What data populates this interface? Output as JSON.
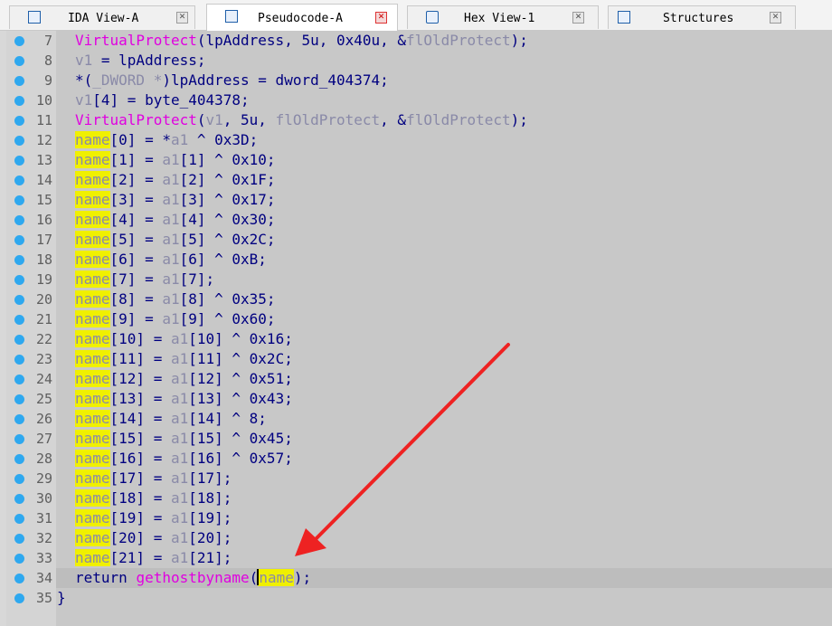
{
  "tabs": [
    {
      "label": "IDA View-A",
      "active": false,
      "icon": "ida-view-icon"
    },
    {
      "label": "Pseudocode-A",
      "active": true,
      "icon": "pseudocode-icon"
    },
    {
      "label": "Hex View-1",
      "active": false,
      "icon": "hex-view-icon"
    },
    {
      "label": "Structures",
      "active": false,
      "icon": "structures-icon"
    }
  ],
  "close_glyph": "✕",
  "colors": {
    "function": "#e000e0",
    "variable": "#8a8aa8",
    "keyword": "#000080",
    "highlight": "#f0f000",
    "breakpoint_dot": "#2ea8ef",
    "arrow": "#ee2222"
  },
  "lines": [
    {
      "num": "7",
      "segments": [
        {
          "t": "VirtualProtect",
          "c": "fn"
        },
        {
          "t": "(lpAddress, 5u, 0x40u, &",
          "c": "kw"
        },
        {
          "t": "flOldProtect",
          "c": "var"
        },
        {
          "t": ");",
          "c": "kw"
        }
      ]
    },
    {
      "num": "8",
      "segments": [
        {
          "t": "v1",
          "c": "var"
        },
        {
          "t": " = lpAddress;",
          "c": "kw"
        }
      ]
    },
    {
      "num": "9",
      "segments": [
        {
          "t": "*(",
          "c": "kw"
        },
        {
          "t": "_DWORD *",
          "c": "var"
        },
        {
          "t": ")lpAddress = dword_404374;",
          "c": "kw"
        }
      ]
    },
    {
      "num": "10",
      "segments": [
        {
          "t": "v1",
          "c": "var"
        },
        {
          "t": "[4] = byte_404378;",
          "c": "kw"
        }
      ]
    },
    {
      "num": "11",
      "segments": [
        {
          "t": "VirtualProtect",
          "c": "fn"
        },
        {
          "t": "(",
          "c": "kw"
        },
        {
          "t": "v1",
          "c": "var"
        },
        {
          "t": ", 5u, ",
          "c": "kw"
        },
        {
          "t": "flOldProtect",
          "c": "var"
        },
        {
          "t": ", &",
          "c": "kw"
        },
        {
          "t": "flOldProtect",
          "c": "var"
        },
        {
          "t": ");",
          "c": "kw"
        }
      ]
    },
    {
      "num": "12",
      "segments": [
        {
          "t": "name",
          "c": "hi"
        },
        {
          "t": "[0] = *",
          "c": "kw"
        },
        {
          "t": "a1",
          "c": "var"
        },
        {
          "t": " ^ 0x3D;",
          "c": "kw"
        }
      ]
    },
    {
      "num": "13",
      "segments": [
        {
          "t": "name",
          "c": "hi"
        },
        {
          "t": "[1] = ",
          "c": "kw"
        },
        {
          "t": "a1",
          "c": "var"
        },
        {
          "t": "[1] ^ 0x10;",
          "c": "kw"
        }
      ]
    },
    {
      "num": "14",
      "segments": [
        {
          "t": "name",
          "c": "hi"
        },
        {
          "t": "[2] = ",
          "c": "kw"
        },
        {
          "t": "a1",
          "c": "var"
        },
        {
          "t": "[2] ^ 0x1F;",
          "c": "kw"
        }
      ]
    },
    {
      "num": "15",
      "segments": [
        {
          "t": "name",
          "c": "hi"
        },
        {
          "t": "[3] = ",
          "c": "kw"
        },
        {
          "t": "a1",
          "c": "var"
        },
        {
          "t": "[3] ^ 0x17;",
          "c": "kw"
        }
      ]
    },
    {
      "num": "16",
      "segments": [
        {
          "t": "name",
          "c": "hi"
        },
        {
          "t": "[4] = ",
          "c": "kw"
        },
        {
          "t": "a1",
          "c": "var"
        },
        {
          "t": "[4] ^ 0x30;",
          "c": "kw"
        }
      ]
    },
    {
      "num": "17",
      "segments": [
        {
          "t": "name",
          "c": "hi"
        },
        {
          "t": "[5] = ",
          "c": "kw"
        },
        {
          "t": "a1",
          "c": "var"
        },
        {
          "t": "[5] ^ 0x2C;",
          "c": "kw"
        }
      ]
    },
    {
      "num": "18",
      "segments": [
        {
          "t": "name",
          "c": "hi"
        },
        {
          "t": "[6] = ",
          "c": "kw"
        },
        {
          "t": "a1",
          "c": "var"
        },
        {
          "t": "[6] ^ 0xB;",
          "c": "kw"
        }
      ]
    },
    {
      "num": "19",
      "segments": [
        {
          "t": "name",
          "c": "hi"
        },
        {
          "t": "[7] = ",
          "c": "kw"
        },
        {
          "t": "a1",
          "c": "var"
        },
        {
          "t": "[7];",
          "c": "kw"
        }
      ]
    },
    {
      "num": "20",
      "segments": [
        {
          "t": "name",
          "c": "hi"
        },
        {
          "t": "[8] = ",
          "c": "kw"
        },
        {
          "t": "a1",
          "c": "var"
        },
        {
          "t": "[8] ^ 0x35;",
          "c": "kw"
        }
      ]
    },
    {
      "num": "21",
      "segments": [
        {
          "t": "name",
          "c": "hi"
        },
        {
          "t": "[9] = ",
          "c": "kw"
        },
        {
          "t": "a1",
          "c": "var"
        },
        {
          "t": "[9] ^ 0x60;",
          "c": "kw"
        }
      ]
    },
    {
      "num": "22",
      "segments": [
        {
          "t": "name",
          "c": "hi"
        },
        {
          "t": "[10] = ",
          "c": "kw"
        },
        {
          "t": "a1",
          "c": "var"
        },
        {
          "t": "[10] ^ 0x16;",
          "c": "kw"
        }
      ]
    },
    {
      "num": "23",
      "segments": [
        {
          "t": "name",
          "c": "hi"
        },
        {
          "t": "[11] = ",
          "c": "kw"
        },
        {
          "t": "a1",
          "c": "var"
        },
        {
          "t": "[11] ^ 0x2C;",
          "c": "kw"
        }
      ]
    },
    {
      "num": "24",
      "segments": [
        {
          "t": "name",
          "c": "hi"
        },
        {
          "t": "[12] = ",
          "c": "kw"
        },
        {
          "t": "a1",
          "c": "var"
        },
        {
          "t": "[12] ^ 0x51;",
          "c": "kw"
        }
      ]
    },
    {
      "num": "25",
      "segments": [
        {
          "t": "name",
          "c": "hi"
        },
        {
          "t": "[13] = ",
          "c": "kw"
        },
        {
          "t": "a1",
          "c": "var"
        },
        {
          "t": "[13] ^ 0x43;",
          "c": "kw"
        }
      ]
    },
    {
      "num": "26",
      "segments": [
        {
          "t": "name",
          "c": "hi"
        },
        {
          "t": "[14] = ",
          "c": "kw"
        },
        {
          "t": "a1",
          "c": "var"
        },
        {
          "t": "[14] ^ 8;",
          "c": "kw"
        }
      ]
    },
    {
      "num": "27",
      "segments": [
        {
          "t": "name",
          "c": "hi"
        },
        {
          "t": "[15] = ",
          "c": "kw"
        },
        {
          "t": "a1",
          "c": "var"
        },
        {
          "t": "[15] ^ 0x45;",
          "c": "kw"
        }
      ]
    },
    {
      "num": "28",
      "segments": [
        {
          "t": "name",
          "c": "hi"
        },
        {
          "t": "[16] = ",
          "c": "kw"
        },
        {
          "t": "a1",
          "c": "var"
        },
        {
          "t": "[16] ^ 0x57;",
          "c": "kw"
        }
      ]
    },
    {
      "num": "29",
      "segments": [
        {
          "t": "name",
          "c": "hi"
        },
        {
          "t": "[17] = ",
          "c": "kw"
        },
        {
          "t": "a1",
          "c": "var"
        },
        {
          "t": "[17];",
          "c": "kw"
        }
      ]
    },
    {
      "num": "30",
      "segments": [
        {
          "t": "name",
          "c": "hi"
        },
        {
          "t": "[18] = ",
          "c": "kw"
        },
        {
          "t": "a1",
          "c": "var"
        },
        {
          "t": "[18];",
          "c": "kw"
        }
      ]
    },
    {
      "num": "31",
      "segments": [
        {
          "t": "name",
          "c": "hi"
        },
        {
          "t": "[19] = ",
          "c": "kw"
        },
        {
          "t": "a1",
          "c": "var"
        },
        {
          "t": "[19];",
          "c": "kw"
        }
      ]
    },
    {
      "num": "32",
      "segments": [
        {
          "t": "name",
          "c": "hi"
        },
        {
          "t": "[20] = ",
          "c": "kw"
        },
        {
          "t": "a1",
          "c": "var"
        },
        {
          "t": "[20];",
          "c": "kw"
        }
      ]
    },
    {
      "num": "33",
      "segments": [
        {
          "t": "name",
          "c": "hi"
        },
        {
          "t": "[21] = ",
          "c": "kw"
        },
        {
          "t": "a1",
          "c": "var"
        },
        {
          "t": "[21];",
          "c": "kw"
        }
      ]
    },
    {
      "num": "34",
      "current": true,
      "segments": [
        {
          "t": "return ",
          "c": "kw"
        },
        {
          "t": "gethostbyname",
          "c": "fn"
        },
        {
          "t": "(",
          "c": "kw"
        },
        {
          "t": "name",
          "c": "hi",
          "cursor": true
        },
        {
          "t": ");",
          "c": "kw"
        }
      ]
    },
    {
      "num": "35",
      "outdent": true,
      "segments": [
        {
          "t": "}",
          "c": "kw"
        }
      ]
    }
  ]
}
